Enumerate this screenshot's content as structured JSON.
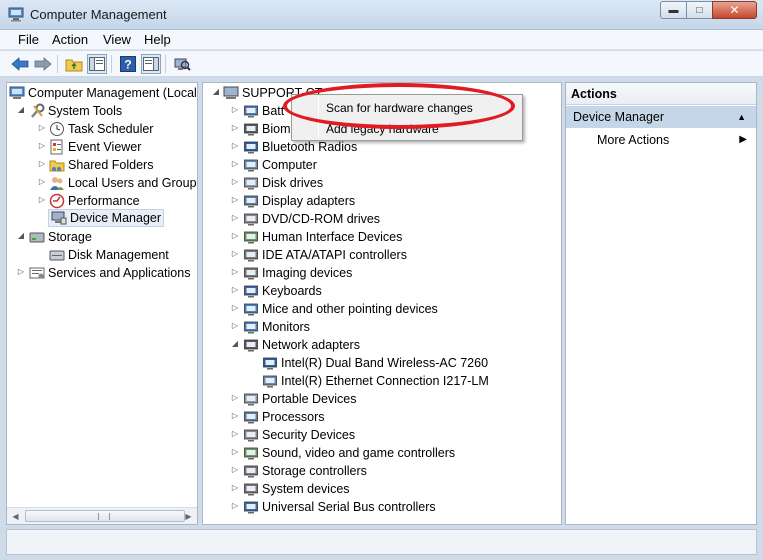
{
  "window": {
    "title": "Computer Management"
  },
  "menu": [
    "File",
    "Action",
    "View",
    "Help"
  ],
  "left_tree": {
    "root": "Computer Management (Local",
    "system_tools": "System Tools",
    "items": [
      "Task Scheduler",
      "Event Viewer",
      "Shared Folders",
      "Local Users and Groups",
      "Performance",
      "Device Manager"
    ],
    "storage": "Storage",
    "disk_management": "Disk Management",
    "services": "Services and Applications"
  },
  "device_tree": {
    "computer": "SUPPORT-CT",
    "partials": [
      "Batt",
      "Biom"
    ],
    "categories": [
      "Bluetooth Radios",
      "Computer",
      "Disk drives",
      "Display adapters",
      "DVD/CD-ROM drives",
      "Human Interface Devices",
      "IDE ATA/ATAPI controllers",
      "Imaging devices",
      "Keyboards",
      "Mice and other pointing devices",
      "Monitors",
      "Network adapters"
    ],
    "network_children": [
      "Intel(R) Dual Band Wireless-AC 7260",
      "Intel(R) Ethernet Connection I217-LM"
    ],
    "more_categories": [
      "Portable Devices",
      "Processors",
      "Security Devices",
      "Sound, video and game controllers",
      "Storage controllers",
      "System devices",
      "Universal Serial Bus controllers"
    ]
  },
  "context_menu": {
    "scan": "Scan for hardware changes",
    "add_legacy": "Add legacy hardware"
  },
  "actions": {
    "header": "Actions",
    "section": "Device Manager",
    "more": "More Actions"
  },
  "colors": {
    "highlight": "#e01b22",
    "actions_section_bg": "#c5d6e9"
  }
}
